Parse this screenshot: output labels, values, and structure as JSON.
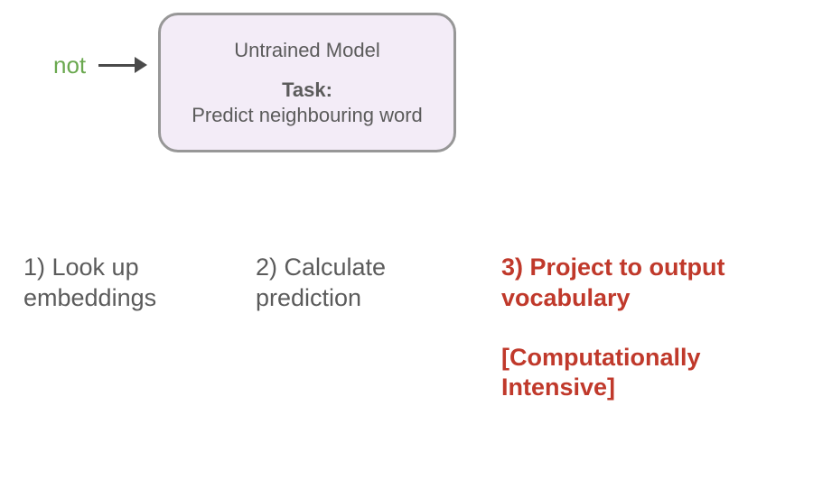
{
  "input": {
    "word": "not"
  },
  "model": {
    "title": "Untrained Model",
    "task_label": "Task:",
    "task_description": "Predict neighbouring word"
  },
  "steps": {
    "one": "1) Look up embeddings",
    "two": "2) Calculate prediction",
    "three_main": "3) Project to output vocabulary",
    "three_sub": "[Computationally Intensive]"
  }
}
